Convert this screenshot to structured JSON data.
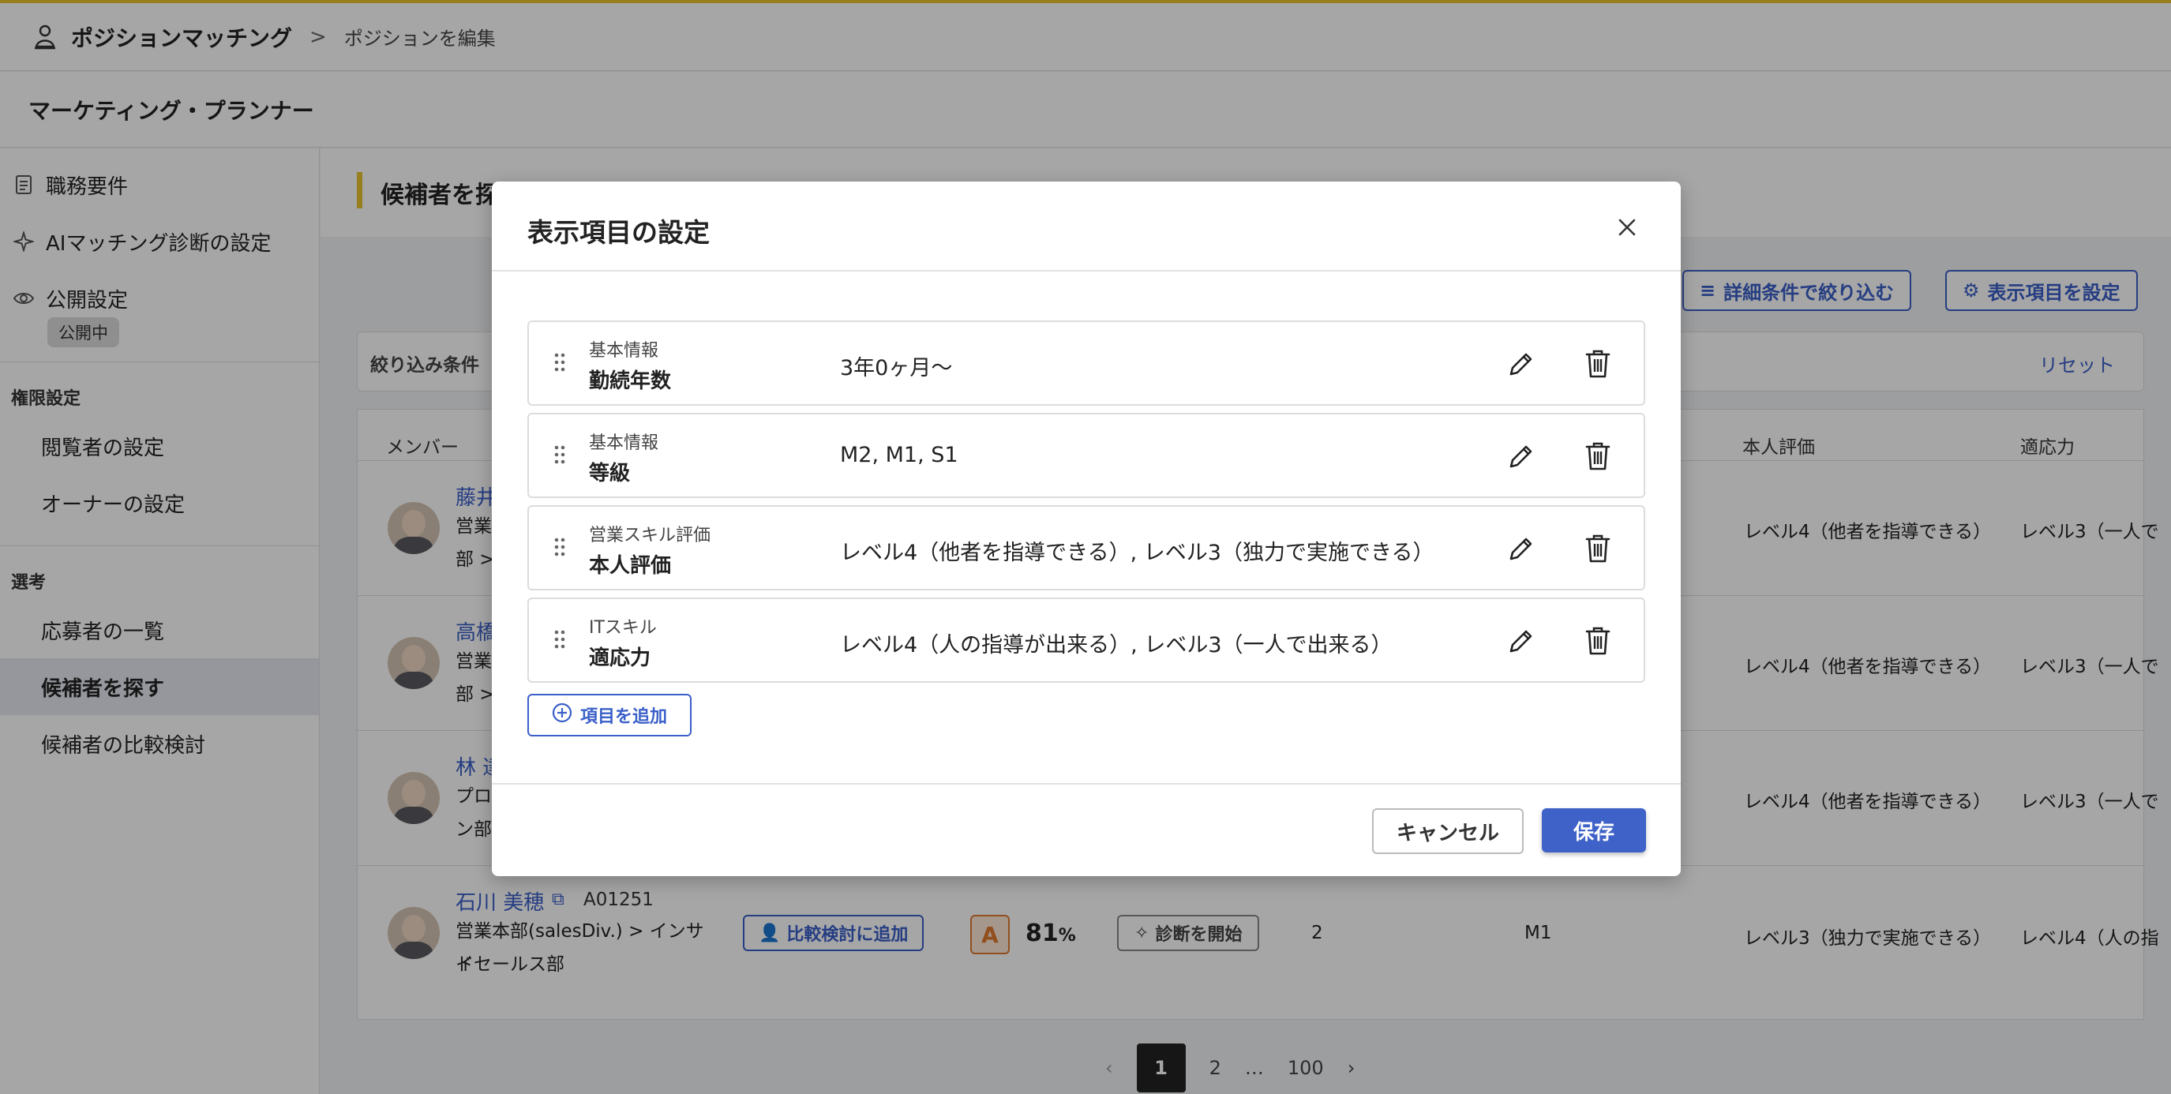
{
  "header": {
    "app_title": "ポジションマッチング",
    "breadcrumb_sep": ">",
    "breadcrumb": "ポジションを編集"
  },
  "position": {
    "title": "マーケティング・プランナー"
  },
  "sidebar": {
    "items": [
      {
        "label": "職務要件",
        "icon": "document-icon"
      },
      {
        "label": "AIマッチング診断の設定",
        "icon": "sparkle-icon"
      },
      {
        "label": "公開設定",
        "icon": "eye-icon"
      }
    ],
    "public_badge": "公開中",
    "permission_section": "権限設定",
    "permission_items": [
      "閲覧者の設定",
      "オーナーの設定"
    ],
    "selection_section": "選考",
    "selection_items": [
      "応募者の一覧",
      "候補者を探す",
      "候補者の比較検討"
    ]
  },
  "main": {
    "title": "候補者を探す",
    "filter_button": "詳細条件で絞り込む",
    "display_button": "表示項目を設定",
    "filter_label": "絞り込み条件",
    "reset": "リセット",
    "columns": {
      "member": "メンバー",
      "self_eval": "本人評価",
      "adapt": "適応力"
    },
    "rows": [
      {
        "name": "藤井",
        "dept1": "営業本",
        "dept2": "部 > I",
        "self_eval": "レベル4（他者を指導できる）",
        "adapt": "レベル3（一人で"
      },
      {
        "name": "高橋",
        "dept1": "営業本",
        "dept2": "部 > ",
        "self_eval": "レベル4（他者を指導できる）",
        "adapt": "レベル3（一人で"
      },
      {
        "name": "林 達",
        "dept1": "プロダ",
        "dept2": "ン部",
        "self_eval": "レベル4（他者を指導できる）",
        "adapt": "レベル3（一人で"
      },
      {
        "name": "石川 美穂",
        "id": "A01251",
        "dept1": "営業本部(salesDiv.) > インサイ",
        "dept2": "ドセールス部",
        "compare": "比較検討に追加",
        "grade_badge": "A",
        "match": "81",
        "match_unit": "%",
        "diagnose": "診断を開始",
        "tenure": "2",
        "grade": "M1",
        "self_eval": "レベル3（独力で実施できる）",
        "adapt": "レベル4（人の指"
      }
    ],
    "pagination": {
      "pages": [
        "1",
        "2",
        "…",
        "100"
      ],
      "current": "1"
    }
  },
  "modal": {
    "title": "表示項目の設定",
    "items": [
      {
        "category": "基本情報",
        "name": "勤続年数",
        "value": "3年0ヶ月〜"
      },
      {
        "category": "基本情報",
        "name": "等級",
        "value": "M2, M1, S1"
      },
      {
        "category": "営業スキル評価",
        "name": "本人評価",
        "value": "レベル4（他者を指導できる）, レベル3（独力で実施できる）"
      },
      {
        "category": "ITスキル",
        "name": "適応力",
        "value": "レベル4（人の指導が出来る）, レベル3（一人で出来る）"
      }
    ],
    "add_label": "項目を追加",
    "cancel_label": "キャンセル",
    "save_label": "保存"
  },
  "colors": {
    "accent": "#e8c432",
    "primary": "#3e62c8",
    "badge_orange": "#e07a2e"
  }
}
